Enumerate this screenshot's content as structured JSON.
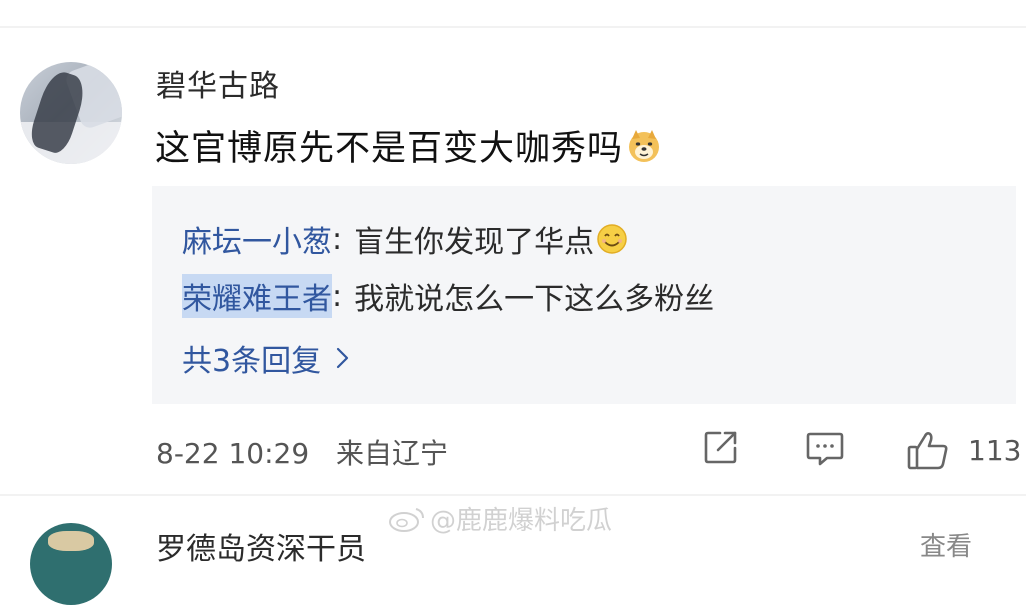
{
  "comment": {
    "username": "碧华古路",
    "text": "这官博原先不是百变大咖秀吗",
    "emoji": "doge-emoji"
  },
  "replies": [
    {
      "name": "麻坛一小葱",
      "separator": ":",
      "text": "盲生你发现了华点",
      "emoji": "smile-emoji"
    },
    {
      "name": "荣耀难王者",
      "separator": ":",
      "text": "我就说怎么一下这么多粉丝"
    }
  ],
  "more_replies": {
    "label": "共3条回复",
    "icon": "chevron-right-icon"
  },
  "meta": {
    "time": "8-22 10:29",
    "location": "来自辽宁"
  },
  "actions": {
    "share_icon": "share-icon",
    "comment_icon": "comment-icon",
    "like_icon": "thumbs-up-icon",
    "like_count": "113"
  },
  "next_comment": {
    "username": "罗德岛资深干员",
    "right_text": "査看"
  },
  "watermark": {
    "text": "@鹿鹿爆料吃瓜"
  },
  "colors": {
    "link_blue": "#31579f",
    "reply_bg": "#f5f6f8",
    "highlight": "#c7d9f3"
  }
}
